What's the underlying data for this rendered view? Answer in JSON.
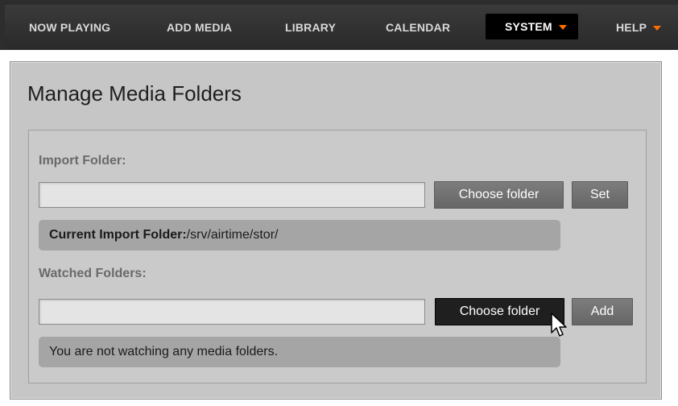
{
  "nav": {
    "items": [
      {
        "label": "NOW PLAYING"
      },
      {
        "label": "ADD MEDIA"
      },
      {
        "label": "LIBRARY"
      },
      {
        "label": "CALENDAR"
      },
      {
        "label": "SYSTEM",
        "active": true,
        "has_dropdown": true
      },
      {
        "label": "HELP",
        "has_dropdown": true
      }
    ]
  },
  "panel": {
    "title": "Manage Media Folders"
  },
  "import": {
    "label": "Import Folder:",
    "input_value": "",
    "choose_label": "Choose folder",
    "set_label": "Set",
    "current_label": "Current Import Folder:",
    "current_value": "/srv/airtime/stor/"
  },
  "watched": {
    "label": "Watched Folders:",
    "input_value": "",
    "choose_label": "Choose folder",
    "add_label": "Add",
    "empty_message": "You are not watching any media folders."
  },
  "colors": {
    "accent": "#ff6f00",
    "nav_background": "#2d2d2d",
    "panel_background": "#c6c6c6"
  },
  "icons": {
    "dropdown": "caret-down-icon",
    "pointer": "mouse-pointer-icon"
  }
}
